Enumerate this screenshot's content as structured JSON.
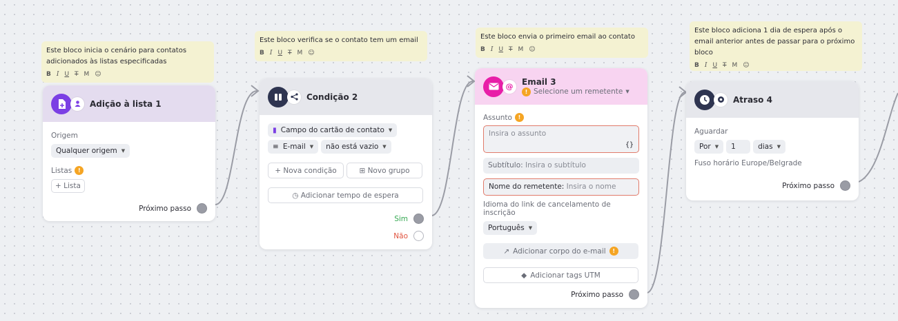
{
  "notes": {
    "n1": {
      "line1": "Este bloco inicia o cenário para contatos",
      "line2": "adicionados às listas especificadas"
    },
    "n2": {
      "line1": "Este bloco verifica se o contato tem um email"
    },
    "n3": {
      "line1": "Este bloco envia o primeiro email ao contato"
    },
    "n4": {
      "line1": "Este bloco adiciona 1 dia de espera após o",
      "line2": "email anterior antes de passar para o próximo",
      "line3": "bloco"
    },
    "toolbar": {
      "bold": "B",
      "italic": "I",
      "underline": "U",
      "strike": "T",
      "mark": "M",
      "emoji": "☺"
    }
  },
  "card1": {
    "title": "Adição à lista 1",
    "origin_label": "Origem",
    "origin_value": "Qualquer origem",
    "lists_label": "Listas",
    "add_list": "+ Lista",
    "next": "Próximo passo",
    "icon_main": "list-add-icon",
    "icon_sub": "person-icon",
    "color": "#7b3fe4",
    "header_bg": "#e4dcef"
  },
  "card2": {
    "title": "Condição 2",
    "field_chip": "Campo do cartão de contato",
    "email_chip": "E-mail",
    "operator_chip": "não está vazio",
    "new_condition": "+ Nova condição",
    "new_group": "⊞ Novo grupo",
    "add_wait": "◷ Adicionar tempo de espera",
    "yes": "Sim",
    "no": "Não",
    "icon_main": "split-icon",
    "icon_sub": "branch-icon",
    "color": "#2e3450",
    "header_bg": "#e6e7ec"
  },
  "card3": {
    "title": "Email 3",
    "sender_select": "Selecione um remetente",
    "subject_label": "Assunto",
    "subject_placeholder": "Insira o assunto",
    "braces": "{}",
    "subtitle_label": "Subtítulo:",
    "subtitle_placeholder": "Insira o subtítulo",
    "sender_name_label": "Nome do remetente:",
    "sender_name_placeholder": "Insira o nome",
    "unsub_label": "Idioma do link de cancelamento de inscrição",
    "language": "Português",
    "add_body": "Adicionar corpo do e-mail",
    "add_utm": "Adicionar tags UTM",
    "next": "Próximo passo",
    "icon_main": "envelope-icon",
    "icon_sub": "at-icon",
    "color": "#e81ea8",
    "header_bg": "#f8d4f1"
  },
  "card4": {
    "title": "Atraso 4",
    "wait_label": "Aguardar",
    "per": "Por",
    "amount": "1",
    "unit": "dias",
    "timezone": "Fuso horário Europe/Belgrade",
    "next": "Próximo passo",
    "icon_main": "clock-icon",
    "icon_sub": "record-icon",
    "color": "#2e3450",
    "header_bg": "#e6e7ec"
  },
  "colors": {
    "success": "#35a852",
    "danger": "#e0523e",
    "warning": "#f5a524"
  }
}
